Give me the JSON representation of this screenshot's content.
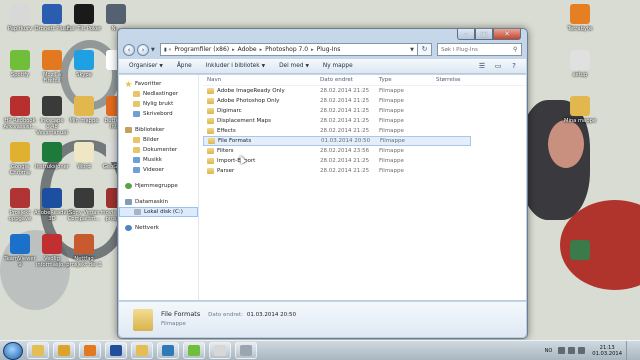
{
  "desktop": {
    "icons_left": [
      {
        "label": "Papirkurv",
        "color": "#d8d8d8"
      },
      {
        "label": "Orbnett Pluss",
        "color": "#2a5db0"
      },
      {
        "label": "Full Tilt Poker",
        "color": "#1a1a1a"
      },
      {
        "label": "N...",
        "color": "#556070"
      },
      {
        "label": "Spotify",
        "color": "#6fbf3a"
      },
      {
        "label": "Mozilla Firefox",
        "color": "#e2791e"
      },
      {
        "label": "Skype",
        "color": "#1ea0e2"
      },
      {
        "label": "",
        "color": "#ffffff"
      },
      {
        "label": "HP Redbook Arkivassist...",
        "color": "#b8302e"
      },
      {
        "label": "Inkscape 0.48 Vevsmanual",
        "color": "#3a3a3a"
      },
      {
        "label": "Min mappe",
        "color": "#e2b84e"
      },
      {
        "label": "Butterfly Intro",
        "color": "#e26a1e"
      },
      {
        "label": "Google Chrome",
        "color": "#e0b030"
      },
      {
        "label": "Instruksjoner",
        "color": "#1e7a3a"
      },
      {
        "label": "Word",
        "color": "#efe6c4"
      },
      {
        "label": "GeoGebra",
        "color": "#dcdcdc"
      },
      {
        "label": "Prosjekt oppgave",
        "color": "#b03434"
      },
      {
        "label": "AdobeReaderXI 3D",
        "color": "#1c4fa0"
      },
      {
        "label": "Sony Vegas Compartm...",
        "color": "#3a3a3a"
      },
      {
        "label": "movie skole prosjekt",
        "color": "#a03030"
      },
      {
        "label": "TeamViewer 9",
        "color": "#1b70c9"
      },
      {
        "label": "Vedlig informasjo...",
        "color": "#c03030"
      },
      {
        "label": "Nettfag prosjekt del 1",
        "color": "#c85a30"
      }
    ],
    "icons_right": [
      {
        "label": "Tetrabyte",
        "color": "#e67e22"
      },
      {
        "label": "setup",
        "color": "#e0e0e0"
      },
      {
        "label": "Mina mappe",
        "color": "#e2b84e"
      },
      {
        "label": "",
        "color": "#3b7a4a"
      }
    ]
  },
  "window": {
    "address": {
      "crumbs": [
        "Programfiler (x86)",
        "Adobe",
        "Photoshop 7.0",
        "Plug-Ins"
      ],
      "search_placeholder": "Søk i Plug-Ins"
    },
    "toolbar": {
      "organize": "Organiser",
      "open": "Åpne",
      "include": "Inkluder i bibliotek",
      "share": "Del med",
      "new_folder": "Ny mappe"
    },
    "nav": {
      "favorites": "Favoritter",
      "favorite_items": [
        "Nedlastinger",
        "Nylig brukt",
        "Skrivebord"
      ],
      "libraries": "Biblioteker",
      "library_items": [
        "Bilder",
        "Dokumenter",
        "Musikk",
        "Videoer"
      ],
      "homegroup": "Hjemmegruppe",
      "computer": "Datamaskin",
      "computer_items": [
        "Lokal disk (C:)"
      ],
      "network": "Nettverk"
    },
    "columns": {
      "name": "Navn",
      "date": "Dato endret",
      "type": "Type",
      "size": "Størrelse"
    },
    "files": [
      {
        "name": "Adobe ImageReady Only",
        "date": "28.02.2014 21:25",
        "type": "Filmappe"
      },
      {
        "name": "Adobe Photoshop Only",
        "date": "28.02.2014 21:25",
        "type": "Filmappe"
      },
      {
        "name": "Digimarc",
        "date": "28.02.2014 21:25",
        "type": "Filmappe"
      },
      {
        "name": "Displacement Maps",
        "date": "28.02.2014 21:25",
        "type": "Filmappe"
      },
      {
        "name": "Effects",
        "date": "28.02.2014 21:25",
        "type": "Filmappe"
      },
      {
        "name": "File Formats",
        "date": "01.03.2014 20:50",
        "type": "Filmappe"
      },
      {
        "name": "Filters",
        "date": "28.02.2014 23:56",
        "type": "Filmappe"
      },
      {
        "name": "Import-Export",
        "date": "28.02.2014 21:25",
        "type": "Filmappe"
      },
      {
        "name": "Parser",
        "date": "28.02.2014 21:25",
        "type": "Filmappe"
      }
    ],
    "details": {
      "name": "File Formats",
      "date_label": "Dato endret:",
      "date_value": "01.03.2014 20:50",
      "type": "Filmappe"
    }
  },
  "taskbar": {
    "apps": [
      {
        "name": "explorer",
        "color": "#e4bd54"
      },
      {
        "name": "chrome",
        "color": "#d9a32c"
      },
      {
        "name": "firefox",
        "color": "#e2791e"
      },
      {
        "name": "word",
        "color": "#1f4f9c"
      },
      {
        "name": "folder",
        "color": "#e4bd54"
      },
      {
        "name": "media",
        "color": "#2d7ab7"
      },
      {
        "name": "spotify",
        "color": "#6fbf3a"
      },
      {
        "name": "app",
        "color": "#d7d7d7"
      },
      {
        "name": "app2",
        "color": "#9aa7b2"
      }
    ],
    "language": "NO",
    "time": "21:13",
    "date": "01.03.2014"
  }
}
